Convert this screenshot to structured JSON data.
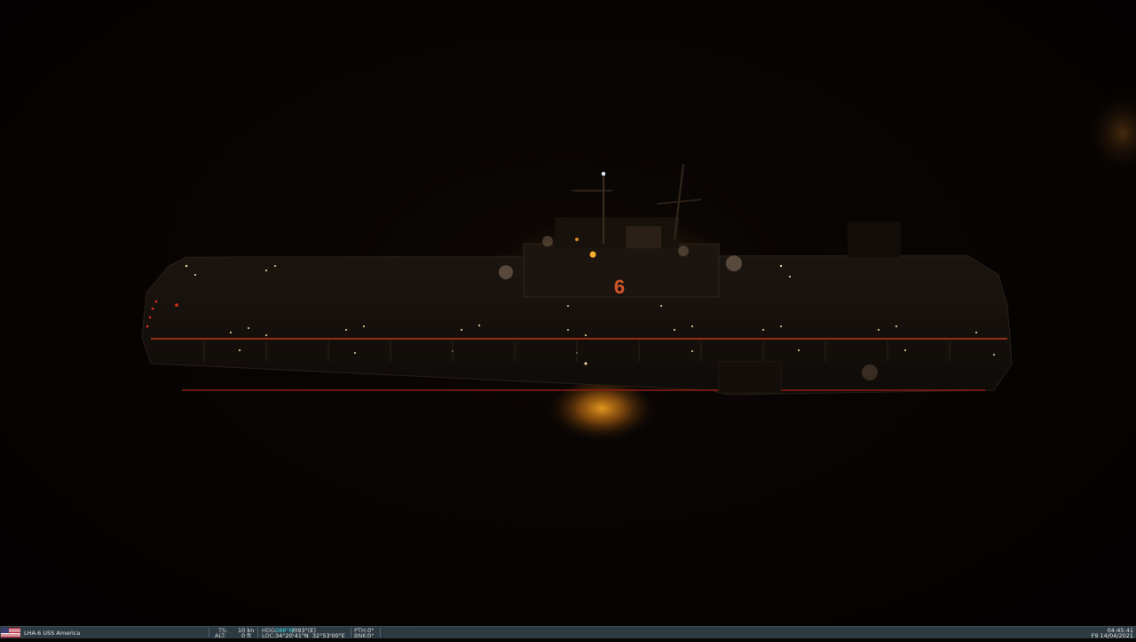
{
  "scene": {
    "hull_number": "6",
    "colors": {
      "sky": "#050302",
      "hull": "#1a1510",
      "glow": "#e08a1c",
      "deck_light": "#ffd89a",
      "red_light": "#c0281a"
    }
  },
  "statusbar": {
    "flag_icon": "us-flag-icon",
    "unit_name": "LHA-6 USS America",
    "ts_label": "TS:",
    "ts_value": "10 kn",
    "alt_label": "ALT:",
    "alt_value": "0 ft",
    "hdg_label": "HDG:",
    "hdg_value_magnetic": "088°M",
    "hdg_value_true": "/093°(E)",
    "loc_label": "LOC:",
    "loc_value": "34°20'41\"N  32°53'00\"E",
    "pth_label": "PTH:",
    "pth_value": "0°",
    "bnk_label": "BNK:",
    "bnk_value": "0°",
    "time": "04:45:41",
    "date": "F9 14/04/2021"
  }
}
